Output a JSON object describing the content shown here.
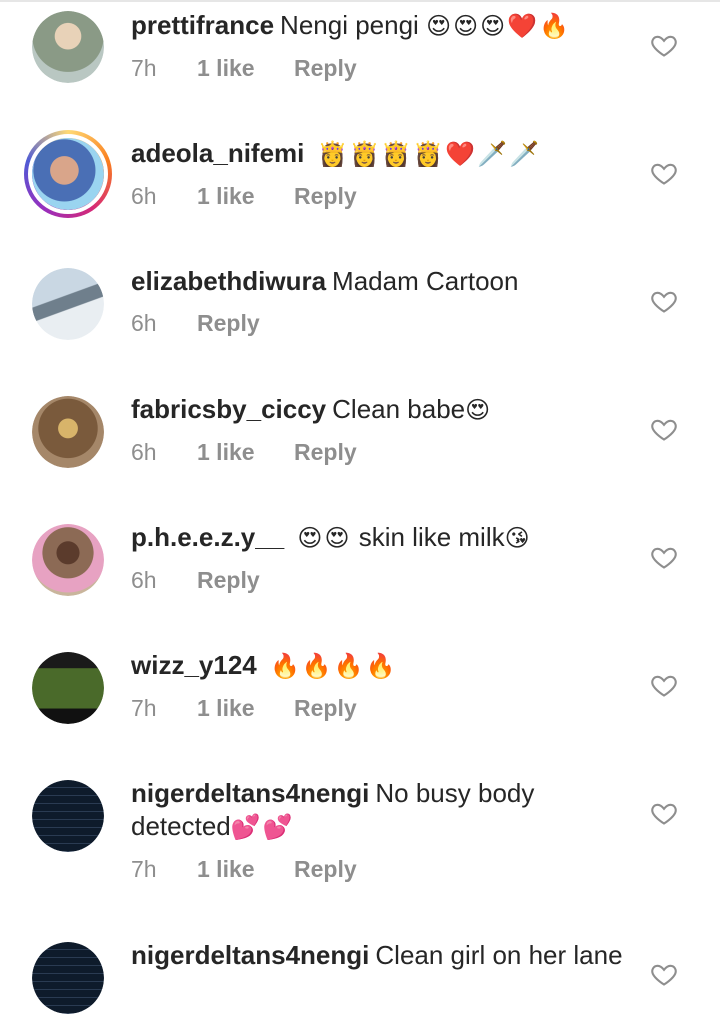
{
  "comments": [
    {
      "username": "prettifrance",
      "text": "Nengi pengi",
      "emoji": "😍😍😍❤️🔥",
      "time": "7h",
      "likes": "1 like",
      "reply": "Reply",
      "avatar_color": "#8a9a86"
    },
    {
      "username": "adeola_nifemi",
      "text": "",
      "emoji": "👸👸👸👸❤️🗡️🗡️",
      "time": "6h",
      "likes": "1 like",
      "reply": "Reply",
      "avatar_color": "#4a6fb5"
    },
    {
      "username": "elizabethdiwura",
      "text": "Madam  Cartoon",
      "emoji": "",
      "time": "6h",
      "likes": "",
      "reply": "Reply",
      "avatar_color": "#a6b8c8"
    },
    {
      "username": "fabricsby_ciccy",
      "text": "Clean babe",
      "emoji": "😍",
      "time": "6h",
      "likes": "1 like",
      "reply": "Reply",
      "avatar_color": "#7a5a3c"
    },
    {
      "username": "p.h.e.e.z.y__",
      "text": "",
      "emoji": "😍😍",
      "text2": "skin like milk",
      "emoji2": "😘",
      "time": "6h",
      "likes": "",
      "reply": "Reply",
      "avatar_color": "#6b4a3a"
    },
    {
      "username": "wizz_y124",
      "text": "",
      "emoji": "🔥🔥🔥🔥",
      "time": "7h",
      "likes": "1 like",
      "reply": "Reply",
      "avatar_color": "#3f5a2a"
    },
    {
      "username": "nigerdeltans4nengi",
      "text": "No busy body detected",
      "emoji": "💕💕",
      "time": "7h",
      "likes": "1 like",
      "reply": "Reply",
      "avatar_color": "#0e1b2b"
    },
    {
      "username": "nigerdeltans4nengi",
      "text": "Clean girl on her lane",
      "emoji": "",
      "time": "",
      "likes": "",
      "reply": "",
      "avatar_color": "#0e1b2b"
    }
  ]
}
